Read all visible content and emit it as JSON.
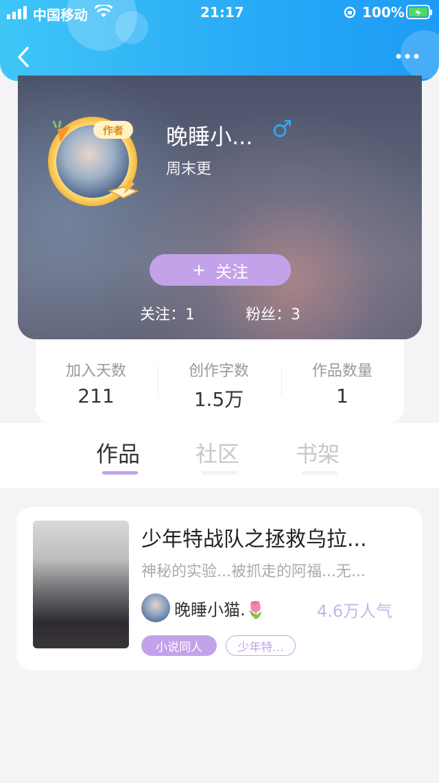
{
  "status_bar": {
    "carrier": "中国移动",
    "time": "21:17",
    "battery": "100%"
  },
  "header": {
    "back_icon": "chevron-left-icon",
    "more_icon": "more-dots-icon"
  },
  "profile": {
    "name": "晚睡小...",
    "gender_symbol": "♂",
    "bio": "周末更",
    "badge": "作者",
    "follow_button": {
      "plus": "+",
      "label": "关注"
    },
    "following": "关注：1",
    "fans": "粉丝：3"
  },
  "stats": [
    {
      "label": "加入天数",
      "value": "211"
    },
    {
      "label": "创作字数",
      "value": "1.5万"
    },
    {
      "label": "作品数量",
      "value": "1"
    }
  ],
  "tabs": [
    {
      "label": "作品",
      "active": true
    },
    {
      "label": "社区",
      "active": false
    },
    {
      "label": "书架",
      "active": false
    }
  ],
  "work": {
    "title": "少年特战队之拯救乌拉...",
    "desc": "神秘的实验...被抓走的阿福...无...",
    "author": "晚睡小猫.🌷",
    "popularity": "4.6万人气",
    "tags": [
      "小说同人",
      "少年特..."
    ]
  },
  "colors": {
    "header": "#27a9f6",
    "accent": "#c3a2ea",
    "gender": "#35a6f0"
  }
}
